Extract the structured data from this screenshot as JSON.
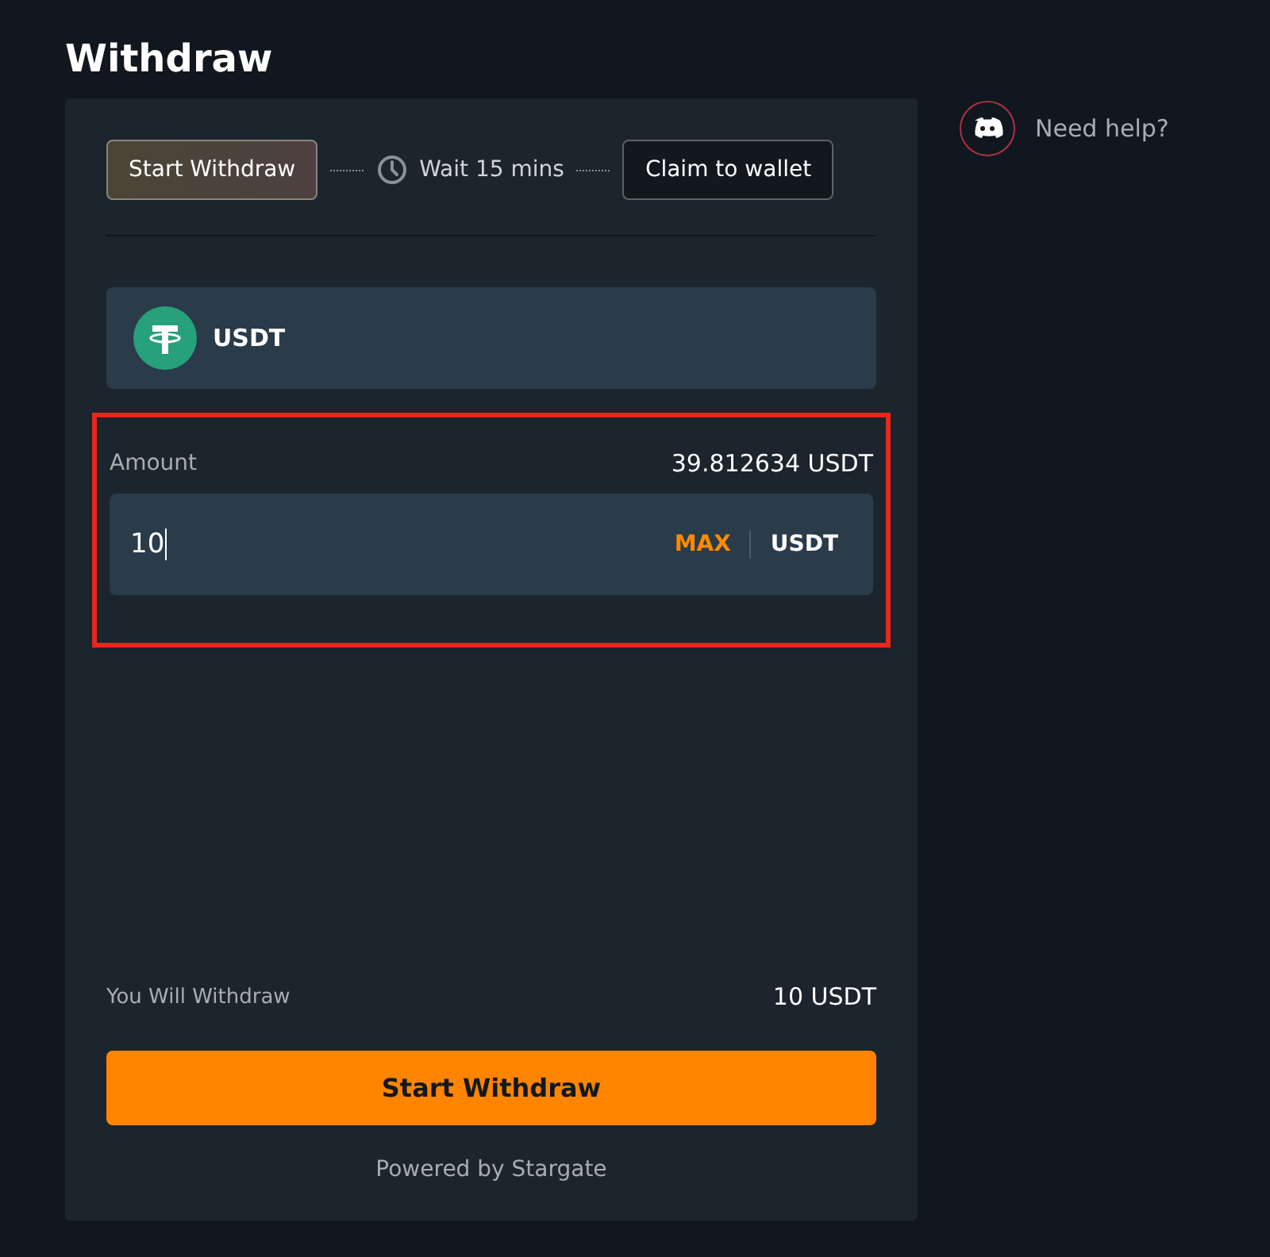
{
  "title": "Withdraw",
  "steps": [
    {
      "kind": "button",
      "label": "Start Withdraw",
      "selected": true
    },
    {
      "kind": "wait",
      "label": "Wait 15 mins"
    },
    {
      "kind": "button",
      "label": "Claim to wallet",
      "selected": false
    }
  ],
  "token": {
    "symbol": "USDT"
  },
  "amount": {
    "label": "Amount",
    "balance": "39.812634 USDT",
    "value": "10",
    "max": "MAX",
    "unit": "USDT",
    "highlighted": true
  },
  "summary": {
    "label": "You Will Withdraw",
    "value": "10 USDT"
  },
  "submit": "Start Withdraw",
  "footer": "Powered by Stargate",
  "help": {
    "label": "Need help?"
  }
}
